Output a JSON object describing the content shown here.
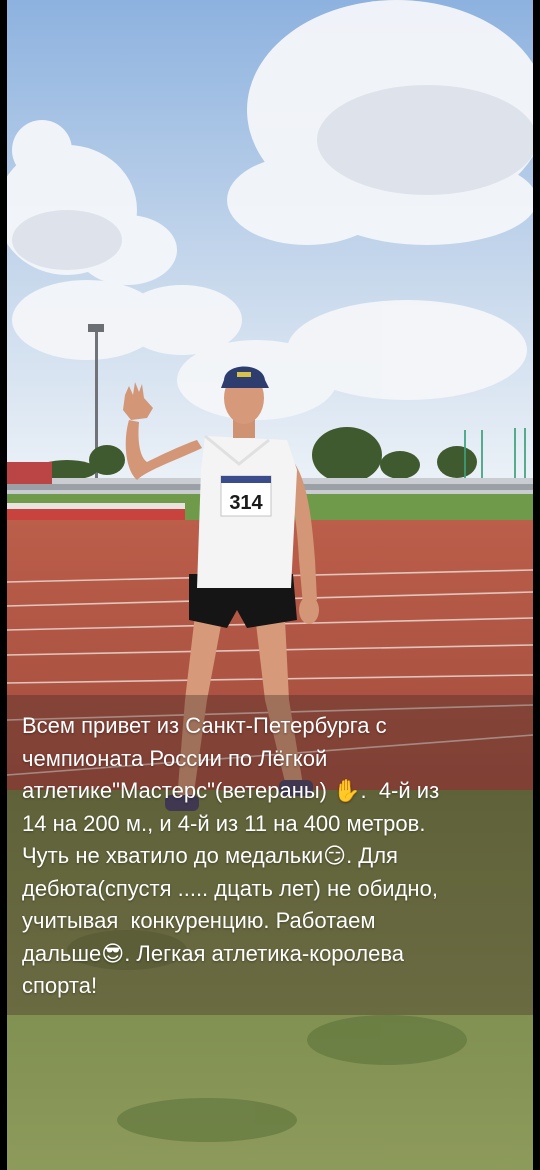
{
  "story": {
    "photo_alt": "",
    "bib_number": "314",
    "caption": "Всем привет из Санкт-Петербурга с\nчемпионата России по Лёгкой\nатлетике\"Мастерс\"(ветераны) ✋.  4-й из\n14 на 200 м., и 4-й из 11 на 400 метров.\nЧуть не хватило до медальки😏. Для\nдебюта(спустя ..... дцать лет) не обидно,\nучитывая  конкуренцию. Работаем\nдальше😎. Легкая атлетика-королева\nспорта!"
  },
  "colors": {
    "sky_top": "#8fb3e0",
    "sky_bottom": "#e6eef7",
    "track": "#b75a48",
    "grass": "#7c8d4f",
    "caption_text": "#ffffff"
  }
}
